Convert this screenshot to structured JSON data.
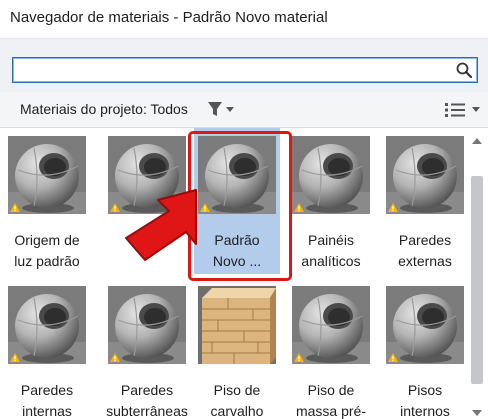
{
  "window": {
    "title": "Navegador de materiais - Padrão Novo material"
  },
  "search": {
    "value": "",
    "placeholder": ""
  },
  "filter": {
    "label": "Materiais do projeto: Todos"
  },
  "materials": [
    {
      "name": "Origem de luz padrão",
      "line1": "Origem de",
      "line2": "luz padrão",
      "thumbnail": "sphere",
      "selected": false,
      "warning": true
    },
    {
      "name": "Padrão",
      "line1": "Pa",
      "line2": "",
      "thumbnail": "sphere",
      "selected": false,
      "warning": true
    },
    {
      "name": "Padrão Novo material",
      "line1": "Padrão",
      "line2": "Novo ...",
      "thumbnail": "sphere",
      "selected": true,
      "warning": true
    },
    {
      "name": "Painéis analíticos",
      "line1": "Painéis",
      "line2": "analíticos",
      "thumbnail": "sphere",
      "selected": false,
      "warning": true
    },
    {
      "name": "Paredes externas",
      "line1": "Paredes",
      "line2": "externas",
      "thumbnail": "sphere",
      "selected": false,
      "warning": true
    },
    {
      "name": "Paredes internas",
      "line1": "Paredes",
      "line2": "internas",
      "thumbnail": "sphere",
      "selected": false,
      "warning": true
    },
    {
      "name": "Paredes subterrâneas",
      "line1": "Paredes",
      "line2": "subterrâneas",
      "thumbnail": "sphere",
      "selected": false,
      "warning": true
    },
    {
      "name": "Piso de carvalho",
      "line1": "Piso de",
      "line2": "carvalho",
      "thumbnail": "wood-cube",
      "selected": false,
      "warning": false
    },
    {
      "name": "Piso de massa pré-",
      "line1": "Piso de",
      "line2": "massa pré-",
      "thumbnail": "sphere",
      "selected": false,
      "warning": true
    },
    {
      "name": "Pisos internos",
      "line1": "Pisos",
      "line2": "internos",
      "thumbnail": "sphere",
      "selected": false,
      "warning": true
    }
  ],
  "colors": {
    "selection": "#b4ccec",
    "highlight": "#e01515",
    "accent": "#2d6db5"
  },
  "icons": {
    "search": "search-icon",
    "filter": "funnel-icon",
    "view": "list-view-icon",
    "warning": "warning-icon"
  }
}
